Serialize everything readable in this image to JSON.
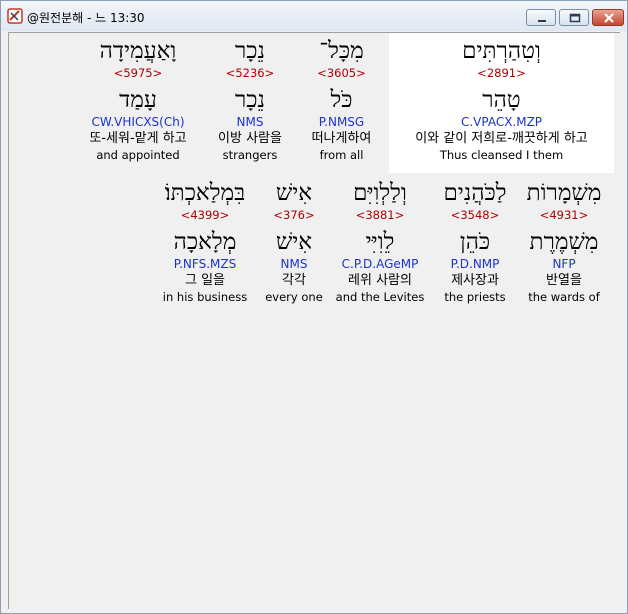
{
  "window": {
    "title": "@원전분해 - 느 13:30"
  },
  "rows": [
    {
      "words": [
        {
          "hebrew": "וְטִהַרְתִּים",
          "strong": "<2891>",
          "lemma": "טָהֵר",
          "parsing": "C.VPACX.MZP",
          "korean": "이와 같이 저희로-깨끗하게 하고",
          "english": "Thus cleansed I them",
          "selected": true
        },
        {
          "hebrew": "מִכָּל־",
          "strong": "<3605>",
          "lemma": "כֹּל",
          "parsing": "P.NMSG",
          "korean": "떠나게하여",
          "english": "from all"
        },
        {
          "hebrew": "נֵכָר",
          "strong": "<5236>",
          "lemma": "נֵכָר",
          "parsing": "NMS",
          "korean": "이방 사람을",
          "english": "strangers"
        },
        {
          "hebrew": "וָאַעֲמִידָה",
          "strong": "<5975>",
          "lemma": "עָמַד",
          "parsing": "CW.VHICXS(Ch)",
          "korean": "또-세워-맡게 하고",
          "english": "and appointed"
        }
      ]
    },
    {
      "words": [
        {
          "hebrew": "מִשְׁמָרוֹת",
          "strong": "<4931>",
          "lemma": "מִשְׁמֶרֶת",
          "parsing": "NFP",
          "korean": "반열을",
          "english": "the wards of"
        },
        {
          "hebrew": "לַכֹּהֲנִים",
          "strong": "<3548>",
          "lemma": "כֹּהֵן",
          "parsing": "P.D.NMP",
          "korean": "제사장과",
          "english": "the priests"
        },
        {
          "hebrew": "וְלַלְוִיִּם",
          "strong": "<3881>",
          "lemma": "לֵוִיִּי",
          "parsing": "C.P.D.AGeMP",
          "korean": "레위 사람의",
          "english": "and the Levites"
        },
        {
          "hebrew": "אִישׁ",
          "strong": "<376>",
          "lemma": "אִישׁ",
          "parsing": "NMS",
          "korean": "각각",
          "english": "every one"
        },
        {
          "hebrew": "בִּמְלַאכְתּוֹ׃",
          "strong": "<4399>",
          "lemma": "מְלָאכָה",
          "parsing": "P.NFS.MZS",
          "korean": "그 일을",
          "english": "in his business"
        }
      ]
    }
  ]
}
